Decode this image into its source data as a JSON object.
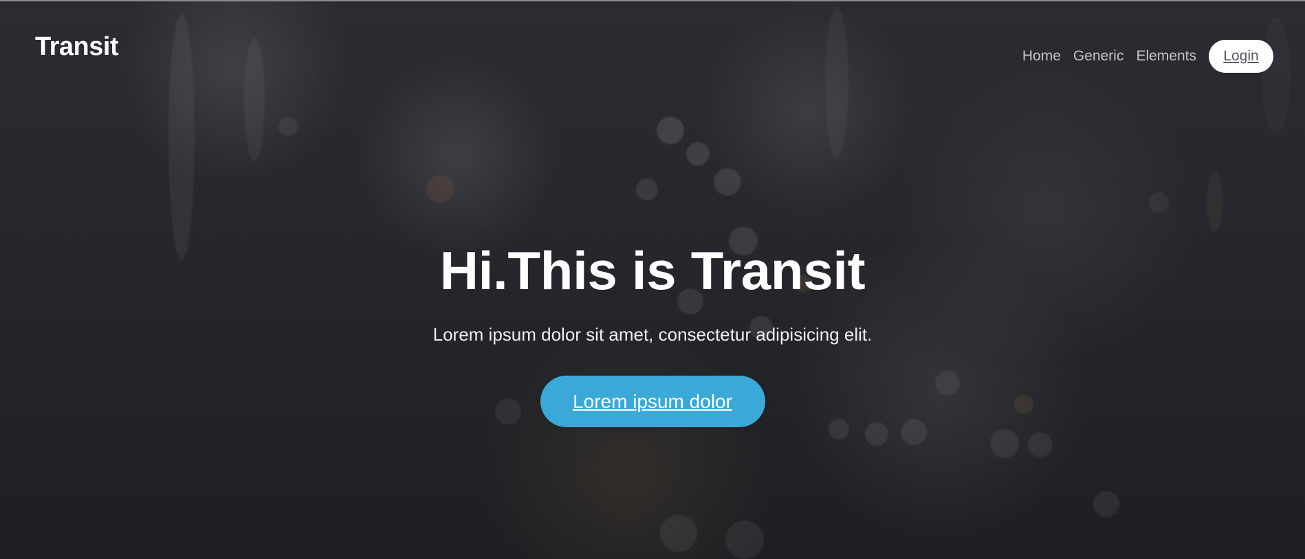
{
  "brand": {
    "logo_text": "Transit"
  },
  "navigation": {
    "items": [
      {
        "label": "Home"
      },
      {
        "label": "Generic"
      },
      {
        "label": "Elements"
      }
    ],
    "login_label": "Login"
  },
  "hero": {
    "title": "Hi.This is Transit",
    "subtitle": "Lorem ipsum dolor sit amet, consectetur adipisicing elit.",
    "cta_label": "Lorem ipsum dolor"
  },
  "colors": {
    "accent": "#3aa9d8",
    "text": "#ffffff",
    "nav_text": "#b8bcc4",
    "login_text": "#555a61"
  }
}
